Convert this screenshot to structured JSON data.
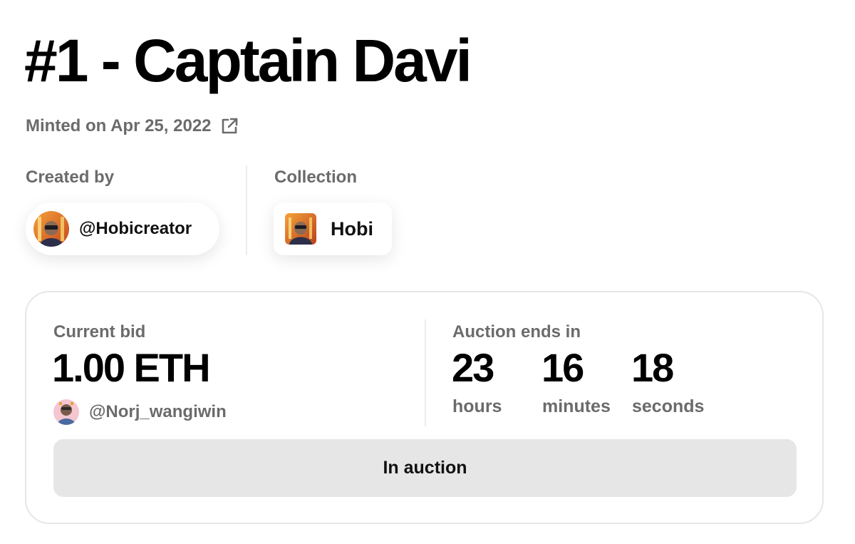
{
  "nft": {
    "title": "#1 - Captain Davi",
    "minted_text": "Minted on Apr 25, 2022",
    "minted_link_icon": "external-link-icon"
  },
  "creator": {
    "label": "Created by",
    "handle": "@Hobicreator"
  },
  "collection": {
    "label": "Collection",
    "name": "Hobi"
  },
  "auction": {
    "bid_label": "Current bid",
    "bid_amount": "1.00 ETH",
    "bidder_handle": "@Norj_wangiwin",
    "ends_label": "Auction ends in",
    "countdown": [
      {
        "value": "23",
        "unit": "hours"
      },
      {
        "value": "16",
        "unit": "minutes"
      },
      {
        "value": "18",
        "unit": "seconds"
      }
    ],
    "status_button": "In auction"
  },
  "colors": {
    "text_primary": "#000000",
    "text_secondary": "#6b6b6b",
    "button_bg": "#e6e6e6",
    "card_border": "#e6e6e6"
  }
}
